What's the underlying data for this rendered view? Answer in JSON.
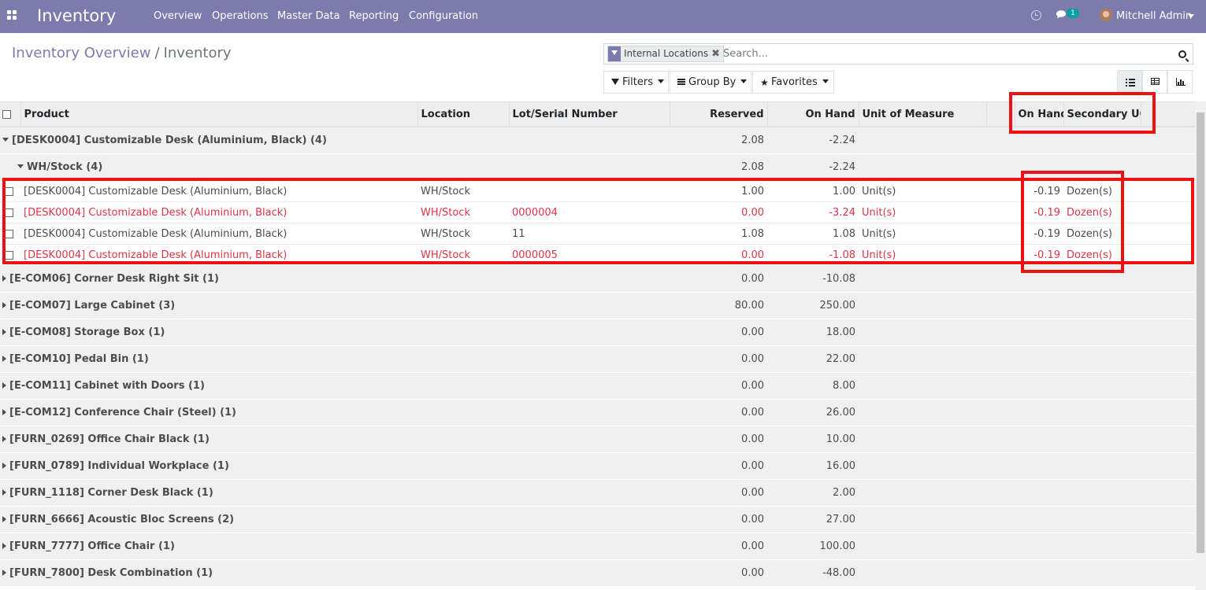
{
  "navbar": {
    "brand": "Inventory",
    "menu": [
      {
        "label": "Overview",
        "name": "menu-overview"
      },
      {
        "label": "Operations",
        "name": "menu-operations"
      },
      {
        "label": "Master Data",
        "name": "menu-master-data"
      },
      {
        "label": "Reporting",
        "name": "menu-reporting"
      },
      {
        "label": "Configuration",
        "name": "menu-configuration"
      }
    ],
    "chat_badge": "1",
    "user": "Mitchell Admin",
    "color": "#7c7bad"
  },
  "breadcrumb": {
    "parent": "Inventory Overview",
    "separator": "/",
    "current": "Inventory"
  },
  "search": {
    "facet_label": "Internal Locations",
    "facet_remove": "✖",
    "placeholder": "Search..."
  },
  "buttons": {
    "filters": "Filters",
    "group_by": "Group By",
    "favorites": "Favorites"
  },
  "views": {
    "active": "list",
    "options": [
      "list",
      "pivot",
      "graph"
    ]
  },
  "table": {
    "columns": {
      "product": "Product",
      "location": "Location",
      "lot": "Lot/Serial Number",
      "reserved": "Reserved",
      "on_hand": "On Hand",
      "uom": "Unit of Measure",
      "on_hand_secondary": "On Hand",
      "secondary_uom": "Secondary UOM"
    },
    "groups": [
      {
        "label": "[DESK0004] Customizable Desk (Aluminium, Black) (4)",
        "reserved": "2.08",
        "on_hand": "-2.24",
        "expanded": true
      },
      {
        "label": "[E-COM06] Corner Desk Right Sit (1)",
        "reserved": "0.00",
        "on_hand": "-10.08"
      },
      {
        "label": "[E-COM07] Large Cabinet (3)",
        "reserved": "80.00",
        "on_hand": "250.00"
      },
      {
        "label": "[E-COM08] Storage Box (1)",
        "reserved": "0.00",
        "on_hand": "18.00"
      },
      {
        "label": "[E-COM10] Pedal Bin (1)",
        "reserved": "0.00",
        "on_hand": "22.00"
      },
      {
        "label": "[E-COM11] Cabinet with Doors (1)",
        "reserved": "0.00",
        "on_hand": "8.00"
      },
      {
        "label": "[E-COM12] Conference Chair (Steel) (1)",
        "reserved": "0.00",
        "on_hand": "26.00"
      },
      {
        "label": "[FURN_0269] Office Chair Black (1)",
        "reserved": "0.00",
        "on_hand": "10.00"
      },
      {
        "label": "[FURN_0789] Individual Workplace (1)",
        "reserved": "0.00",
        "on_hand": "16.00"
      },
      {
        "label": "[FURN_1118] Corner Desk Black (1)",
        "reserved": "0.00",
        "on_hand": "2.00"
      },
      {
        "label": "[FURN_6666] Acoustic Bloc Screens (2)",
        "reserved": "0.00",
        "on_hand": "27.00"
      },
      {
        "label": "[FURN_7777] Office Chair (1)",
        "reserved": "0.00",
        "on_hand": "100.00"
      },
      {
        "label": "[FURN_7800] Desk Combination (1)",
        "reserved": "0.00",
        "on_hand": "-48.00"
      }
    ],
    "subgroup": {
      "label": "WH/Stock (4)",
      "reserved": "2.08",
      "on_hand": "-2.24"
    },
    "records": [
      {
        "product": "[DESK0004] Customizable Desk (Aluminium, Black)",
        "location": "WH/Stock",
        "lot": "",
        "reserved": "1.00",
        "on_hand": "1.00",
        "uom": "Unit(s)",
        "sec_on_hand": "-0.19",
        "sec_uom": "Dozen(s)",
        "danger": false
      },
      {
        "product": "[DESK0004] Customizable Desk (Aluminium, Black)",
        "location": "WH/Stock",
        "lot": "0000004",
        "reserved": "0.00",
        "on_hand": "-3.24",
        "uom": "Unit(s)",
        "sec_on_hand": "-0.19",
        "sec_uom": "Dozen(s)",
        "danger": true
      },
      {
        "product": "[DESK0004] Customizable Desk (Aluminium, Black)",
        "location": "WH/Stock",
        "lot": "11",
        "reserved": "1.08",
        "on_hand": "1.08",
        "uom": "Unit(s)",
        "sec_on_hand": "-0.19",
        "sec_uom": "Dozen(s)",
        "danger": false
      },
      {
        "product": "[DESK0004] Customizable Desk (Aluminium, Black)",
        "location": "WH/Stock",
        "lot": "0000005",
        "reserved": "0.00",
        "on_hand": "-1.08",
        "uom": "Unit(s)",
        "sec_on_hand": "-0.19",
        "sec_uom": "Dozen(s)",
        "danger": true
      }
    ]
  },
  "colors": {
    "danger": "#dc3545",
    "annotation": "#ee1111",
    "accent": "#7c7bad"
  }
}
